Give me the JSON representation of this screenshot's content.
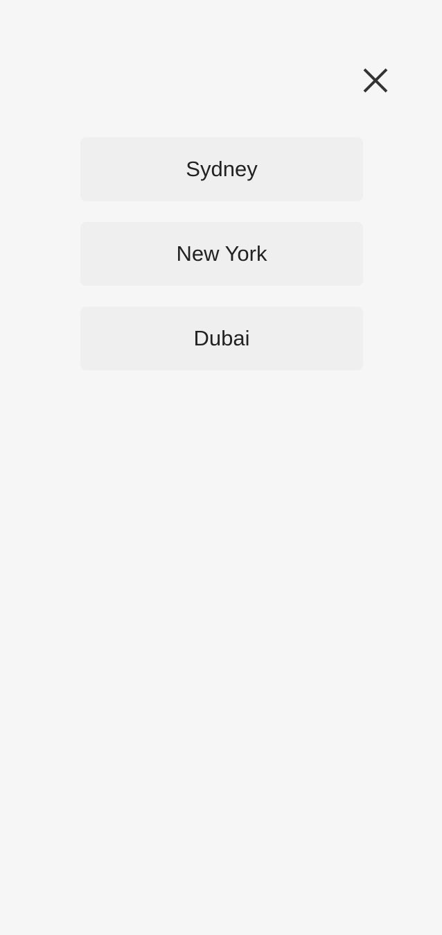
{
  "menu": {
    "close_icon": "close-icon",
    "cities": [
      {
        "label": "Sydney"
      },
      {
        "label": "New York"
      },
      {
        "label": "Dubai"
      }
    ]
  },
  "colors": {
    "background": "#f6f6f6",
    "button_background": "#efefef",
    "text": "#222222",
    "icon": "#333333"
  }
}
